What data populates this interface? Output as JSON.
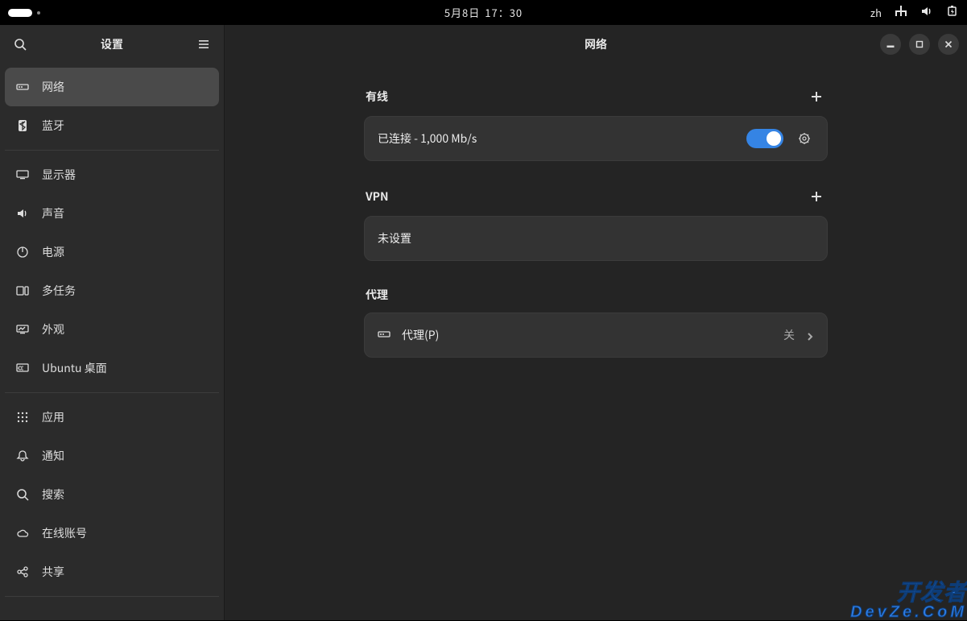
{
  "topbar": {
    "date": "5月8日",
    "time": "17：30",
    "lang": "zh"
  },
  "sidebar": {
    "title": "设置",
    "groups": [
      [
        {
          "id": "network",
          "label": "网络",
          "icon": "network-icon",
          "active": true
        },
        {
          "id": "bluetooth",
          "label": "蓝牙",
          "icon": "bluetooth-icon"
        }
      ],
      [
        {
          "id": "displays",
          "label": "显示器",
          "icon": "display-icon"
        },
        {
          "id": "sound",
          "label": "声音",
          "icon": "sound-icon"
        },
        {
          "id": "power",
          "label": "电源",
          "icon": "power-icon"
        },
        {
          "id": "multitask",
          "label": "多任务",
          "icon": "multitask-icon"
        },
        {
          "id": "appearance",
          "label": "外观",
          "icon": "appearance-icon"
        },
        {
          "id": "ubuntu",
          "label": "Ubuntu 桌面",
          "icon": "ubuntu-icon"
        }
      ],
      [
        {
          "id": "apps",
          "label": "应用",
          "icon": "apps-icon"
        },
        {
          "id": "notif",
          "label": "通知",
          "icon": "bell-icon"
        },
        {
          "id": "search",
          "label": "搜索",
          "icon": "search-icon"
        },
        {
          "id": "online",
          "label": "在线账号",
          "icon": "cloud-icon"
        },
        {
          "id": "sharing",
          "label": "共享",
          "icon": "share-icon"
        }
      ]
    ]
  },
  "content": {
    "title": "网络",
    "wired": {
      "heading": "有线",
      "status": "已连接 - 1,000 Mb/s",
      "enabled": true
    },
    "vpn": {
      "heading": "VPN",
      "status": "未设置"
    },
    "proxy": {
      "heading": "代理",
      "label": "代理(P)",
      "status": "关"
    }
  },
  "watermark": {
    "line1": "开发者",
    "line2": "DevZe.CoM"
  }
}
